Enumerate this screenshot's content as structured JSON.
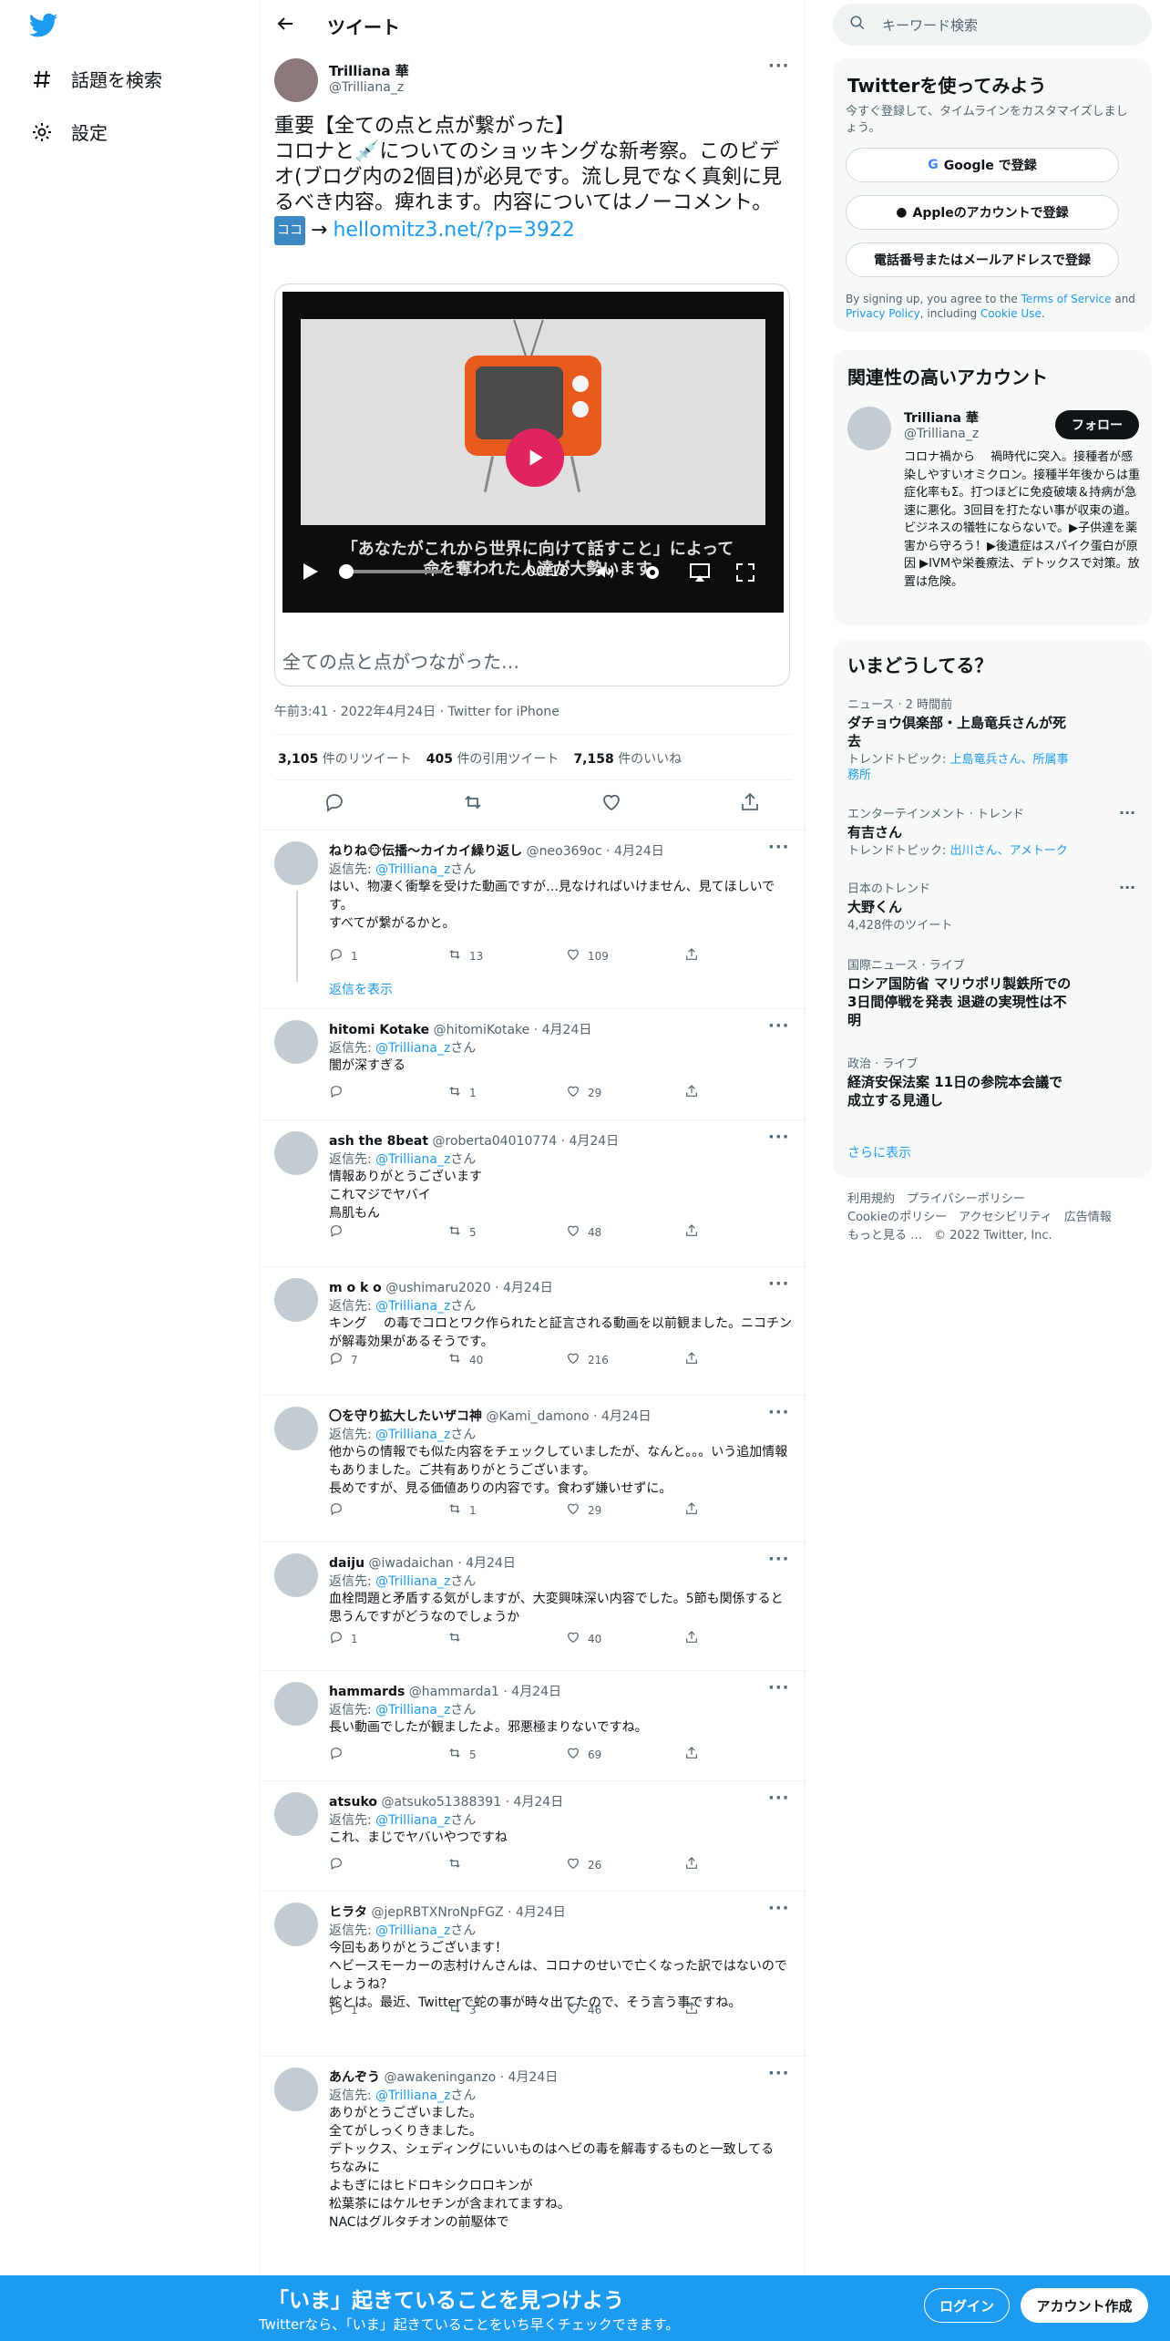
{
  "nav": {
    "explore": "話題を検索",
    "settings": "設定"
  },
  "header": {
    "title": "ツイート"
  },
  "tweet": {
    "author_name": "Trilliana 華",
    "author_handle": "@Trilliana_z",
    "text_line1": "重要【全ての点と点が繋がった】",
    "text_line2": "コロナと💉についてのショッキングな新考察。このビデオ(ブログ内の2個目)が必見です。流し見でなく真剣に見るべき内容。痺れます。内容についてはノーコメント。",
    "koko": "ココ",
    "arrow": "→",
    "link": "hellomitz3.net/?p=3922",
    "card_title": "全ての点と点がつながった…",
    "video_subtitle": "「あなたがこれから世界に向けて話すこと」によって命を奪われた人達が大勢います",
    "video_time": "00:16",
    "timestamp": "午前3:41 · 2022年4月24日 · Twitter for iPhone",
    "retweets": "3,105",
    "retweets_label": "件のリツイート",
    "quotes": "405",
    "quotes_label": "件の引用ツイート",
    "likes": "7,158",
    "likes_label": "件のいいね"
  },
  "replies": [
    {
      "name": "ねりね🐵伝播〜カイカイ繰り返し",
      "handle": "@neo369oc",
      "date": "· 4月24日",
      "to_label": "返信先:",
      "to": "@Trilliana_z",
      "san": "さん",
      "body": "はい、物凄く衝撃を受けた動画ですが…見なければいけません、見てほしいです。\nすべてが繋がるかと。",
      "reply": "1",
      "rt": "13",
      "like": "109",
      "show_replies": "返信を表示"
    },
    {
      "name": "hitomi Kotake",
      "handle": "@hitomiKotake",
      "date": "· 4月24日",
      "to_label": "返信先:",
      "to": "@Trilliana_z",
      "san": "さん",
      "body": "闇が深すぎる",
      "reply": "",
      "rt": "1",
      "like": "29"
    },
    {
      "name": "ash the 8beat",
      "handle": "@roberta04010774",
      "date": "· 4月24日",
      "to_label": "返信先:",
      "to": "@Trilliana_z",
      "san": "さん",
      "body": "情報ありがとうございます\nこれマジでヤバイ\n鳥肌もん",
      "reply": "",
      "rt": "5",
      "like": "48"
    },
    {
      "name": "m o k o",
      "handle": "@ushimaru2020",
      "date": "· 4月24日",
      "to_label": "返信先:",
      "to": "@Trilliana_z",
      "san": "さん",
      "body": "キング　 の毒でコロとワク作られたと証言される動画を以前観ました。ニコチンが解毒効果があるそうです。",
      "reply": "7",
      "rt": "40",
      "like": "216"
    },
    {
      "name": "〇を守り拡大したいザコ神",
      "handle": "@Kami_damono",
      "date": "· 4月24日",
      "to_label": "返信先:",
      "to": "@Trilliana_z",
      "san": "さん",
      "body": "他からの情報でも似た内容をチェックしていましたが、なんと。。。いう追加情報もありました。ご共有ありがとうございます。\n長めですが、見る価値ありの内容です。食わず嫌いせずに。",
      "reply": "",
      "rt": "1",
      "like": "29"
    },
    {
      "name": "daiju",
      "handle": "@iwadaichan",
      "date": "· 4月24日",
      "to_label": "返信先:",
      "to": "@Trilliana_z",
      "san": "さん",
      "body": "血栓問題と矛盾する気がしますが、大変興味深い内容でした。5節も関係すると思うんですがどうなのでしょうか",
      "reply": "1",
      "rt": "",
      "like": "40"
    },
    {
      "name": "hammards",
      "handle": "@hammarda1",
      "date": "· 4月24日",
      "to_label": "返信先:",
      "to": "@Trilliana_z",
      "san": "さん",
      "body": "長い動画でしたが観ましたよ。邪悪極まりないですね。",
      "reply": "",
      "rt": "5",
      "like": "69"
    },
    {
      "name": "atsuko",
      "handle": "@atsuko51388391",
      "date": "· 4月24日",
      "to_label": "返信先:",
      "to": "@Trilliana_z",
      "san": "さん",
      "body": "これ、まじでヤバいやつですね",
      "reply": "",
      "rt": "",
      "like": "26"
    },
    {
      "name": "ヒラタ",
      "handle": "@jepRBTXNroNpFGZ",
      "date": "· 4月24日",
      "to_label": "返信先:",
      "to": "@Trilliana_z",
      "san": "さん",
      "body": "今回もありがとうございます！\nヘビースモーカーの志村けんさんは、コロナのせいで亡くなった訳ではないのでしょうね？\n蛇とは。最近、Twitterで蛇の事が時々出てたので、そう言う事ですね。",
      "reply": "1",
      "rt": "3",
      "like": "46"
    },
    {
      "name": "あんぞう",
      "handle": "@awakeninganzo",
      "date": "· 4月24日",
      "to_label": "返信先:",
      "to": "@Trilliana_z",
      "san": "さん",
      "body": "ありがとうございました。\n全てがしっくりきました。\nデトックス、シェディングにいいものはヘビの毒を解毒するものと一致してる\nちなみに\nよもぎにはヒドロキシクロロキンが\n松葉茶にはケルセチンが含まれてますね。\nNACはグルタチオンの前駆体で",
      "reply": "",
      "rt": "",
      "like": ""
    }
  ],
  "right": {
    "search_placeholder": "キーワード検索",
    "signup": {
      "title": "Twitterを使ってみよう",
      "desc": "今すぐ登録して、タイムラインをカスタマイズしましょう。",
      "google": "Google で登録",
      "apple": "Appleのアカウントで登録",
      "phone": "電話番号またはメールアドレスで登録",
      "terms_1": "By signing up, you agree to the ",
      "terms_tos": "Terms of Service",
      "terms_2": " and ",
      "terms_pp": "Privacy Policy",
      "terms_3": ", including ",
      "terms_cookie": "Cookie Use",
      "terms_4": "."
    },
    "related": {
      "title": "関連性の高いアカウント",
      "name": "Trilliana 華",
      "handle": "@Trilliana_z",
      "follow": "フォロー",
      "bio": "コロナ禍から　 禍時代に突入。接種者が感染しやすいオミクロン。接種半年後からは重症化率もΣ。打つほどに免疫破壊＆持病が急速に悪化。3回目を打たない事が収束の道。　 ビジネスの犠牲にならないで。▶子供達を薬害から守ろう！▶後遺症はスパイク蛋白が原因 ▶IVMや栄養療法、デトックスで対策。放置は危険。"
    },
    "trends": {
      "title": "いまどうしてる？",
      "items": [
        {
          "cat": "ニュース · 2 時間前",
          "title": "ダチョウ倶楽部・上島竜兵さんが死去",
          "sub_label": "トレンドトピック: ",
          "sub_links": "上島竜兵さん、所属事務所"
        },
        {
          "cat": "エンターテインメント · トレンド",
          "title": "有吉さん",
          "sub_label": "トレンドトピック: ",
          "sub_links": "出川さん、アメトーク"
        },
        {
          "cat": "日本のトレンド",
          "title": "大野くん",
          "sub_label": "4,428件のツイート",
          "sub_links": ""
        },
        {
          "cat": "国際ニュース · ライブ",
          "title": "ロシア国防省 マリウポリ製鉄所での3日間停戦を発表 退避の実現性は不明",
          "sub_label": "",
          "sub_links": ""
        },
        {
          "cat": "政治 · ライブ",
          "title": "経済安保法案 11日の参院本会議で成立する見通し",
          "sub_label": "",
          "sub_links": ""
        }
      ],
      "more": "さらに表示"
    },
    "footer": {
      "l1": "利用規約",
      "l2": "プライバシーポリシー",
      "l3": "Cookieのポリシー",
      "l4": "アクセシビリティ",
      "l5": "広告情報",
      "l6": "もっと見る …",
      "copy": "© 2022 Twitter, Inc."
    }
  },
  "bottom": {
    "title": "「いま」起きていることを見つけよう",
    "sub": "Twitterなら、「いま」起きていることをいち早くチェックできます。",
    "login": "ログイン",
    "signup": "アカウント作成"
  },
  "colors": {
    "accent": "#1d9bf0",
    "text": "#0f1419",
    "muted": "#536471"
  }
}
